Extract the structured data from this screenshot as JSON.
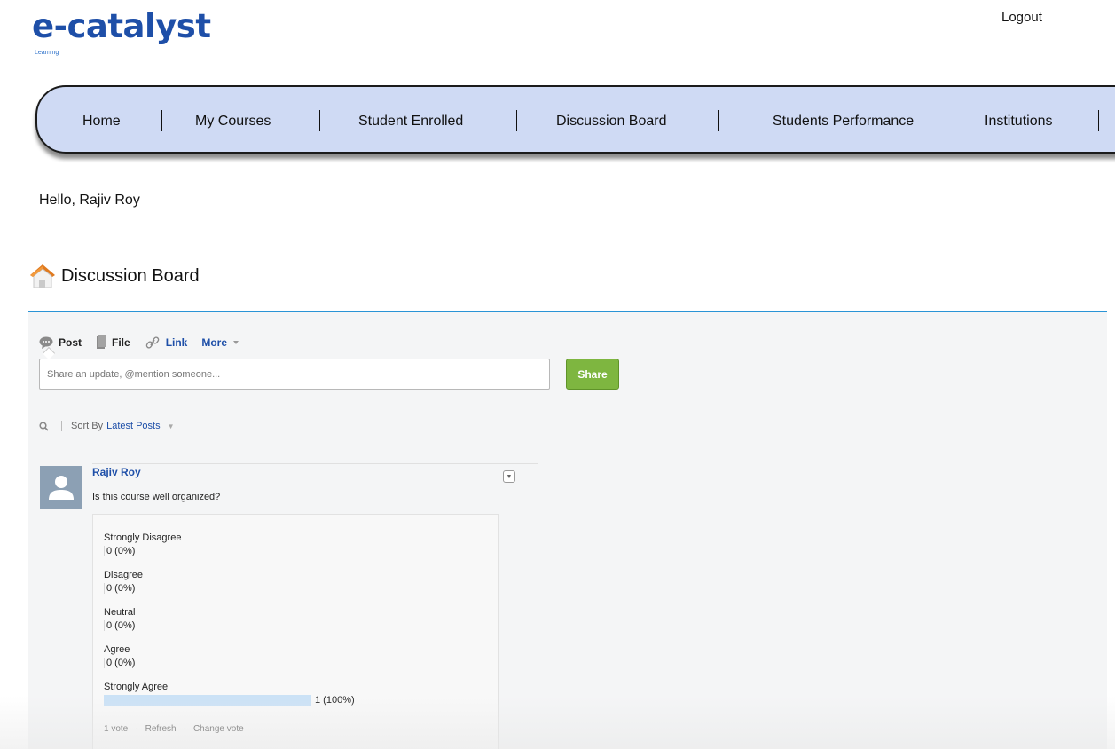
{
  "header": {
    "logo_text": "e-catalyst",
    "logo_subtext": "Learning",
    "logout_label": "Logout"
  },
  "nav": {
    "items": [
      {
        "label": "Home"
      },
      {
        "label": "My Courses"
      },
      {
        "label": "Student Enrolled"
      },
      {
        "label": "Discussion Board"
      },
      {
        "label": "Students Performance"
      },
      {
        "label": "Institutions"
      }
    ]
  },
  "greeting": "Hello, Rajiv Roy",
  "page_title": "Discussion Board",
  "publisher": {
    "tabs": [
      {
        "label": "Post",
        "icon": "chat-bubble-icon"
      },
      {
        "label": "File",
        "icon": "file-icon"
      },
      {
        "label": "Link",
        "icon": "link-icon"
      },
      {
        "label": "More",
        "icon": "chevron-down-icon"
      }
    ],
    "placeholder": "Share an update, @mention someone...",
    "share_label": "Share"
  },
  "sort": {
    "label": "Sort By",
    "value": "Latest Posts"
  },
  "post": {
    "author": "Rajiv Roy",
    "question": "Is this course well organized?",
    "poll": {
      "options": [
        {
          "label": "Strongly Disagree",
          "result": "0 (0%)",
          "fraction": 0
        },
        {
          "label": "Disagree",
          "result": "0 (0%)",
          "fraction": 0
        },
        {
          "label": "Neutral",
          "result": "0 (0%)",
          "fraction": 0
        },
        {
          "label": "Agree",
          "result": "0 (0%)",
          "fraction": 0
        },
        {
          "label": "Strongly Agree",
          "result": "1 (100%)",
          "fraction": 1
        }
      ],
      "vote_count": "1 vote",
      "refresh_label": "Refresh",
      "change_vote_label": "Change vote"
    }
  },
  "colors": {
    "nav_background": "#cfdaf4",
    "link_blue": "#1e4fa8",
    "share_green": "#7eb640",
    "panel_accent": "#2a94d6",
    "poll_bar": "#cbe2f6"
  }
}
